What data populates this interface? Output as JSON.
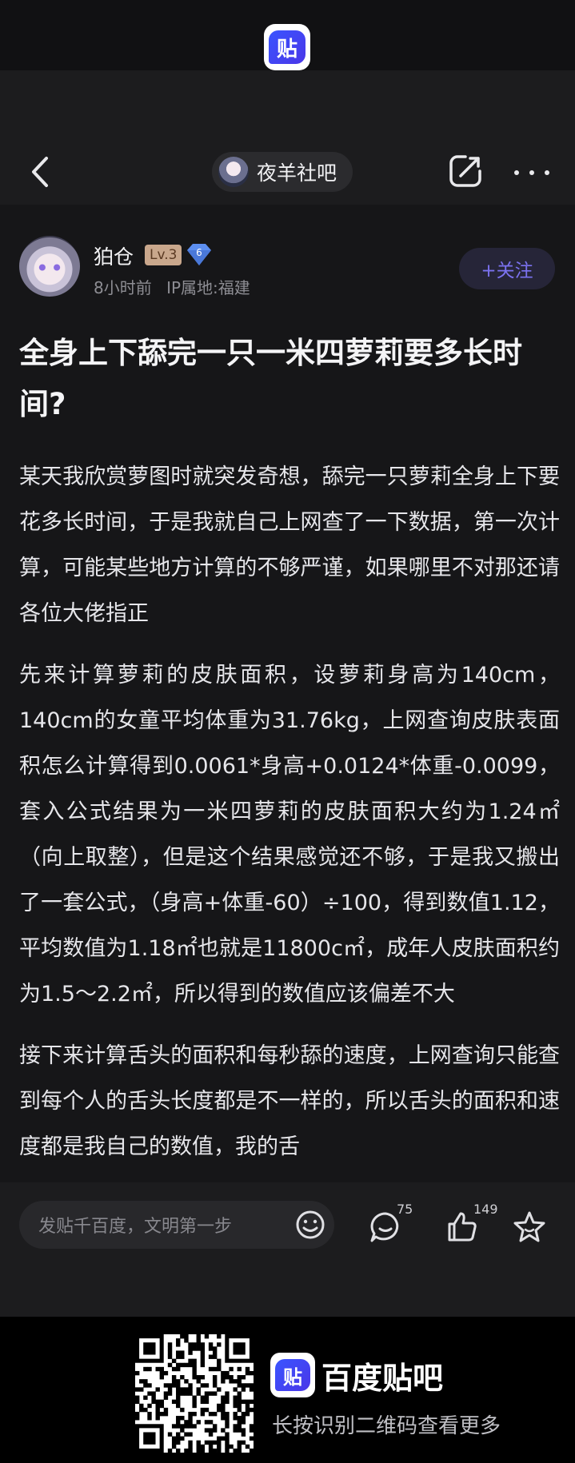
{
  "app": {
    "logo_char": "贴"
  },
  "header": {
    "forum_name": "夜羊社吧"
  },
  "author": {
    "name": "狛仓",
    "level": "Lv.3",
    "badge_number": "6",
    "time": "8小时前",
    "ip_location": "IP属地:福建",
    "follow_label": "+关注"
  },
  "post": {
    "title": "全身上下舔完一只一米四萝莉要多长时间?",
    "paragraphs": [
      "某天我欣赏萝图时就突发奇想，舔完一只萝莉全身上下要花多长时间，于是我就自己上网查了一下数据，第一次计算，可能某些地方计算的不够严谨，如果哪里不对那还请各位大佬指正",
      "先来计算萝莉的皮肤面积，设萝莉身高为140cm，140cm的女童平均体重为31.76kg，上网查询皮肤表面积怎么计算得到0.0061*身高+0.0124*体重-0.0099，套入公式结果为一米四萝莉的皮肤面积大约为1.24㎡（向上取整），但是这个结果感觉还不够，于是我又搬出了一套公式，（身高+体重-60）÷100，得到数值1.12，平均数值为1.18㎡也就是11800c㎡，成年人皮肤面积约为1.5～2.2㎡，所以得到的数值应该偏差不大",
      "接下来计算舌头的面积和每秒舔的速度，上网查询只能查到每个人的舌头长度都是不一样的，所以舌头的面积和速度都是我自己的数值，我的舌"
    ]
  },
  "bottom_bar": {
    "input_placeholder": "发贴千百度，文明第一步",
    "comment_count": "75",
    "like_count": "149"
  },
  "footer": {
    "brand_name": "百度贴吧",
    "tagline": "长按识别二维码查看更多"
  },
  "colors": {
    "background": "#161618",
    "accent": "#7b72ef",
    "brand_blue": "#3a55ff"
  }
}
